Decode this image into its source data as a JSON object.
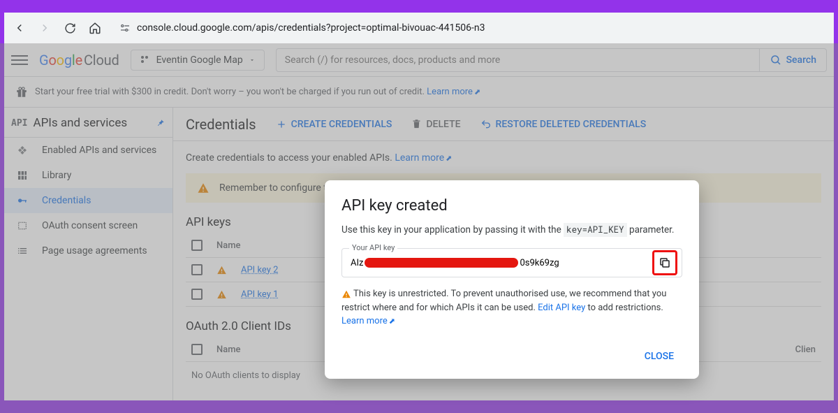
{
  "browser": {
    "url": "console.cloud.google.com/apis/credentials?project=optimal-bivouac-441506-n3"
  },
  "header": {
    "logo_cloud": "Cloud",
    "project_name": "Eventin Google Map",
    "search_placeholder": "Search (/) for resources, docs, products and more",
    "search_btn": "Search"
  },
  "promo": {
    "text": "Start your free trial with $300 in credit. Don't worry – you won't be charged if you run out of credit. ",
    "link": "Learn more"
  },
  "sidebar": {
    "api_label": "API",
    "title": "APIs and services",
    "items": [
      {
        "label": "Enabled APIs and services"
      },
      {
        "label": "Library"
      },
      {
        "label": "Credentials"
      },
      {
        "label": "OAuth consent screen"
      },
      {
        "label": "Page usage agreements"
      }
    ]
  },
  "content": {
    "title": "Credentials",
    "actions": {
      "create": "CREATE CREDENTIALS",
      "delete": "DELETE",
      "restore": "RESTORE DELETED CREDENTIALS"
    },
    "intro_text": "Create credentials to access your enabled APIs. ",
    "intro_link": "Learn more",
    "warning": "Remember to configure t",
    "api_keys_heading": "API keys",
    "col_name": "Name",
    "keys": [
      {
        "name": "API key 2"
      },
      {
        "name": "API key 1"
      }
    ],
    "oauth_heading": "OAuth 2.0 Client IDs",
    "oauth_col_name": "Name",
    "oauth_col_client": "Clien",
    "oauth_empty": "No OAuth clients to display"
  },
  "modal": {
    "title": "API key created",
    "desc_before": "Use this key in your application by passing it with the ",
    "desc_code": "key=API_KEY",
    "desc_after": " parameter.",
    "key_label": "Your API key",
    "key_prefix": "AIz",
    "key_suffix": "0s9k69zg",
    "warn_before": "This key is unrestricted. To prevent unauthorised use, we recommend that you restrict where and for which APIs it can be used. ",
    "warn_link1": "Edit API key",
    "warn_mid": " to add restrictions. ",
    "warn_link2": "Learn more",
    "close": "CLOSE"
  }
}
